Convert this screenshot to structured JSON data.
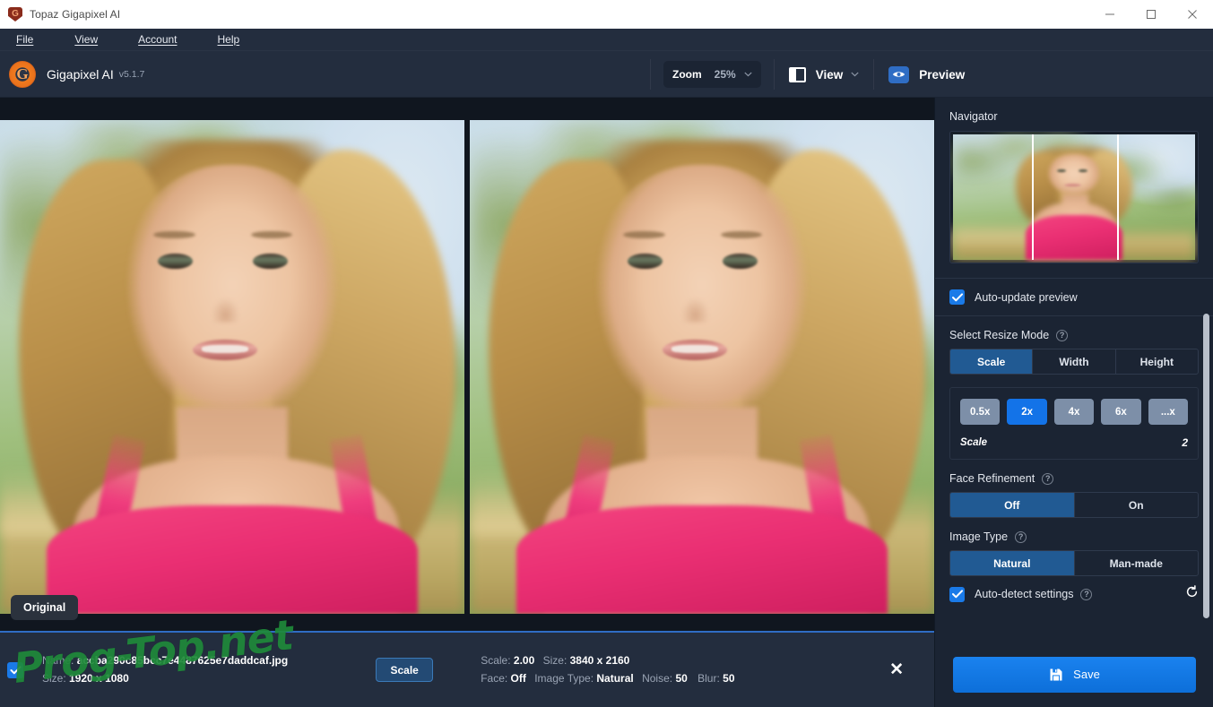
{
  "window": {
    "title": "Topaz Gigapixel AI",
    "app_icon": "topaz-shield-icon",
    "minimize_label": "–",
    "maximize_label": "□",
    "close_label": "✕"
  },
  "menubar": {
    "items": [
      {
        "label": "File",
        "mnemonic": "F"
      },
      {
        "label": "View",
        "mnemonic": "V"
      },
      {
        "label": "Account",
        "mnemonic": "A"
      },
      {
        "label": "Help",
        "mnemonic": "H"
      }
    ]
  },
  "header": {
    "brand_letter": "G",
    "brand_name": "Gigapixel AI",
    "version": "v5.1.7"
  },
  "toolbar": {
    "zoom_label": "Zoom",
    "zoom_value": "25%",
    "zoom_caret": "⌄",
    "view_label": "View",
    "view_caret": "⌄",
    "preview_label": "Preview",
    "view_icon": "split-view-icon",
    "preview_icon": "eye-icon"
  },
  "canvas": {
    "original_badge": "Original",
    "left_pane_name": "original-image-pane",
    "right_pane_name": "processed-image-pane"
  },
  "panel": {
    "navigator_title": "Navigator",
    "auto_update": {
      "label": "Auto-update preview",
      "checked": true
    },
    "resize_mode": {
      "title": "Select Resize Mode",
      "help": "?",
      "options": [
        "Scale",
        "Width",
        "Height"
      ],
      "selected": "Scale"
    },
    "scale_presets": {
      "options": [
        "0.5x",
        "2x",
        "4x",
        "6x",
        "...x"
      ],
      "selected": "2x",
      "row_label": "Scale",
      "row_value": "2"
    },
    "face_refinement": {
      "title": "Face Refinement",
      "help": "?",
      "options": [
        "Off",
        "On"
      ],
      "selected": "Off"
    },
    "image_type": {
      "title": "Image Type",
      "help": "?",
      "options": [
        "Natural",
        "Man-made"
      ],
      "selected": "Natural"
    },
    "auto_detect": {
      "label": "Auto-detect settings",
      "help": "?",
      "checked": true,
      "reset_icon": "refresh-icon"
    },
    "save_button": {
      "label": "Save",
      "icon": "floppy-disk-icon"
    }
  },
  "bottombar": {
    "checked": true,
    "name_key": "Name:",
    "name_value": "accba290c85bcc7e4487625e7daddcaf.jpg",
    "size_key": "Size:",
    "size_value": "1920 x 1080",
    "scale_chip": "Scale",
    "out_scale_key": "Scale:",
    "out_scale_value": "2.00",
    "out_size_key": "Size:",
    "out_size_value": "3840 x 2160",
    "face_key": "Face:",
    "face_value": "Off",
    "image_type_key": "Image Type:",
    "image_type_value": "Natural",
    "noise_key": "Noise:",
    "noise_value": "50",
    "blur_key": "Blur:",
    "blur_value": "50",
    "close_label": "✕"
  },
  "watermark": {
    "text": "Prog-Top.net"
  },
  "colors": {
    "panel_bg": "#1b2433",
    "header_bg": "#232d3e",
    "canvas_bg": "#10161f",
    "accent_blue": "#1373e8",
    "segment_active": "#215a93",
    "preset_idle": "#7d8fa8",
    "watermark_green": "#1f8a3a"
  }
}
